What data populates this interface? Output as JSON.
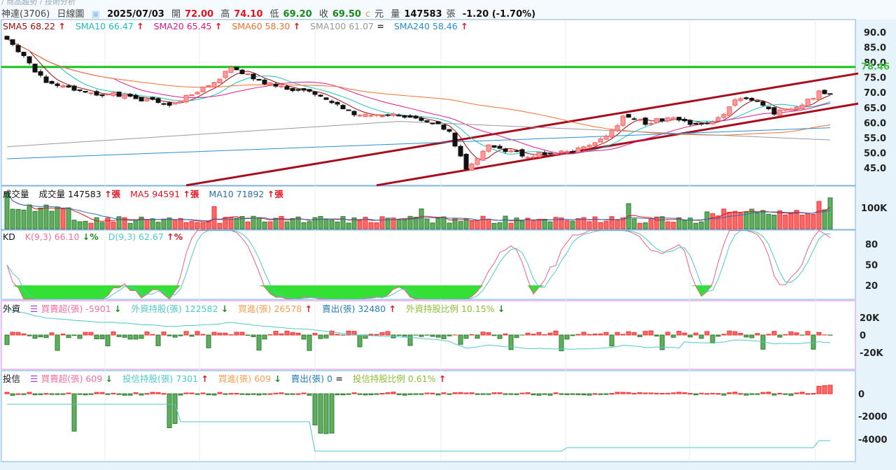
{
  "breadcrumb": "/ 商品趨勢 / 技術分析",
  "header": {
    "stock": "神達(3706)",
    "chart_type": "日線圖",
    "date": "2025/07/03",
    "open_label": "開",
    "open": "72.00",
    "high_label": "高",
    "high": "74.10",
    "low_label": "低",
    "low": "69.20",
    "close_label": "收",
    "close": "69.50",
    "c": "c",
    "unit": "元",
    "vol_label": "量",
    "volume": "147583",
    "vol_unit": "張",
    "change": "-1.20 (-1.70%)"
  },
  "legends": {
    "price": [
      {
        "t": "SMA5 68.22",
        "a": "↑",
        "c": "#9b0a0a"
      },
      {
        "t": "SMA10 66.47",
        "a": "↑",
        "c": "#1bbfbf"
      },
      {
        "t": "SMA20 65.45",
        "a": "↑",
        "c": "#e0198a"
      },
      {
        "t": "SMA60 58.30",
        "a": "↑",
        "c": "#f07030"
      },
      {
        "t": "SMA100 61.07",
        "a": "=",
        "c": "#999999"
      },
      {
        "t": "SMA240 58.46",
        "a": "↑",
        "c": "#2b8ed0"
      }
    ],
    "volume": [
      {
        "t": "成交量",
        "a": "",
        "c": "#111"
      },
      {
        "t": "成交量 147583",
        "a": "↑張",
        "c": "#111"
      },
      {
        "t": "MA5 94591",
        "a": "↑張",
        "c": "#e3141d"
      },
      {
        "t": "MA10 71892",
        "a": "↑張",
        "c": "#2a6fb5"
      }
    ],
    "kd": [
      {
        "t": "KD",
        "a": "",
        "c": "#111"
      },
      {
        "t": "K(9,3) 66.10",
        "a": "↓%",
        "c": "#f0709a"
      },
      {
        "t": "D(9,3) 62.67",
        "a": "↑%",
        "c": "#4cc9c9"
      }
    ],
    "foreign": [
      {
        "t": "外資",
        "a": "",
        "c": "#111"
      },
      {
        "t": "買賣超(張) -5901",
        "a": "↓",
        "c": "#f0709a"
      },
      {
        "t": "外資持股(張) 122582",
        "a": "↓",
        "c": "#4cc9c9"
      },
      {
        "t": "買進(張) 26578",
        "a": "↑",
        "c": "#f5a050"
      },
      {
        "t": "賣出(張) 32480",
        "a": "↑",
        "c": "#2a7fb5"
      },
      {
        "t": "外資持股比例 10.15%",
        "a": "↓",
        "c": "#8cbf30"
      }
    ],
    "trust": [
      {
        "t": "投信",
        "a": "",
        "c": "#111"
      },
      {
        "t": "買賣超(張) 609",
        "a": "↓",
        "c": "#f0709a"
      },
      {
        "t": "投信持股(張) 7301",
        "a": "↑",
        "c": "#4cc9c9"
      },
      {
        "t": "買進(張) 609",
        "a": "↓",
        "c": "#f5a050"
      },
      {
        "t": "賣出(張) 0",
        "a": "=",
        "c": "#2a7fb5"
      },
      {
        "t": "投信持股比例 0.61%",
        "a": "↑",
        "c": "#8cbf30"
      }
    ]
  },
  "chart_data": {
    "type": "candlestick",
    "bars": 148,
    "price_keypoints": [
      [
        0,
        88
      ],
      [
        7,
        73
      ],
      [
        15,
        70
      ],
      [
        20,
        69
      ],
      [
        29,
        66
      ],
      [
        36,
        72
      ],
      [
        40,
        78
      ],
      [
        48,
        72
      ],
      [
        54,
        70
      ],
      [
        62,
        63
      ],
      [
        70,
        62
      ],
      [
        76,
        60
      ],
      [
        79,
        57
      ],
      [
        82,
        44
      ],
      [
        86,
        52
      ],
      [
        93,
        49
      ],
      [
        101,
        51
      ],
      [
        107,
        55
      ],
      [
        110,
        62
      ],
      [
        114,
        60
      ],
      [
        119,
        62
      ],
      [
        123,
        59
      ],
      [
        127,
        61
      ],
      [
        130,
        68
      ],
      [
        134,
        67
      ],
      [
        137,
        63
      ],
      [
        142,
        66
      ],
      [
        145,
        70
      ],
      [
        147,
        69.5
      ]
    ],
    "price_axis": {
      "ticks": [
        "90.0",
        "85.0",
        "80.0",
        "75.0",
        "70.0",
        "65.0",
        "60.0",
        "55.0",
        "50.0",
        "45.0"
      ],
      "range": [
        40,
        92
      ]
    },
    "resistance_level": "78.46",
    "channel_upper": [
      [
        32,
        39.2
      ],
      [
        152,
        76.3
      ]
    ],
    "channel_lower": [
      [
        66,
        39.2
      ],
      [
        152,
        66.3
      ]
    ],
    "volume_axis": [
      "100K"
    ],
    "kd_axis": [
      "80",
      "50",
      "20"
    ],
    "foreign_axis": [
      "20K",
      "0",
      "-20K"
    ],
    "trust_axis": [
      "0",
      "-2000",
      "-4000"
    ]
  }
}
